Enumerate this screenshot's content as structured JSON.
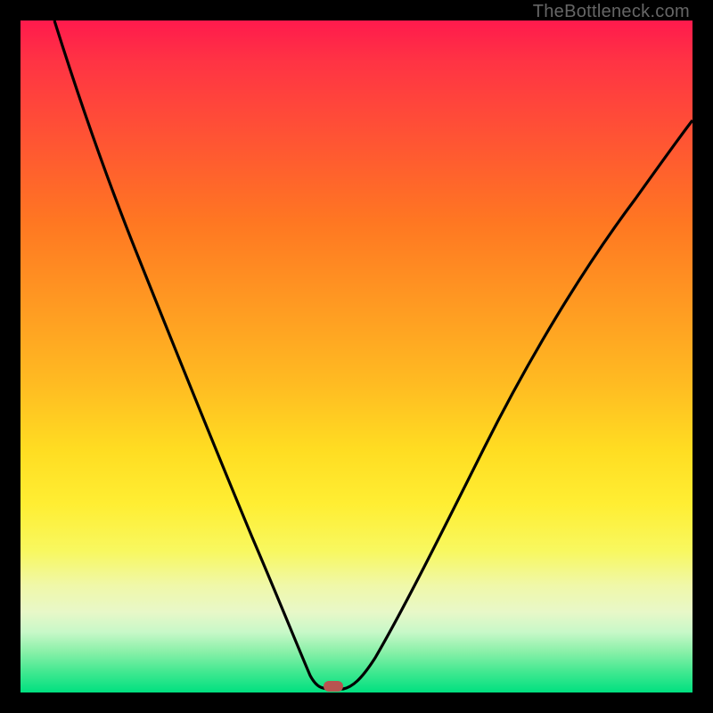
{
  "watermark": "TheBottleneck.com",
  "colors": {
    "frame": "#000000",
    "curve": "#000000",
    "marker": "#b85450"
  },
  "chart_data": {
    "type": "line",
    "title": "",
    "xlabel": "",
    "ylabel": "",
    "xlim": [
      0,
      100
    ],
    "ylim": [
      0,
      100
    ],
    "x": [
      5,
      8,
      12,
      16,
      20,
      24,
      28,
      32,
      35,
      38,
      40,
      42,
      43.5,
      45,
      47,
      48,
      50,
      53,
      57,
      62,
      68,
      75,
      83,
      92,
      100
    ],
    "values": [
      100,
      90,
      80,
      70,
      60,
      50,
      40,
      30,
      22,
      14,
      8,
      4,
      1.5,
      0.5,
      0.5,
      1,
      3,
      8,
      16,
      26,
      38,
      52,
      66,
      78,
      86
    ],
    "marker": {
      "x": 46,
      "y": 0.5
    },
    "grid": false,
    "legend": false,
    "background": "vertical-gradient red-yellow-green"
  }
}
